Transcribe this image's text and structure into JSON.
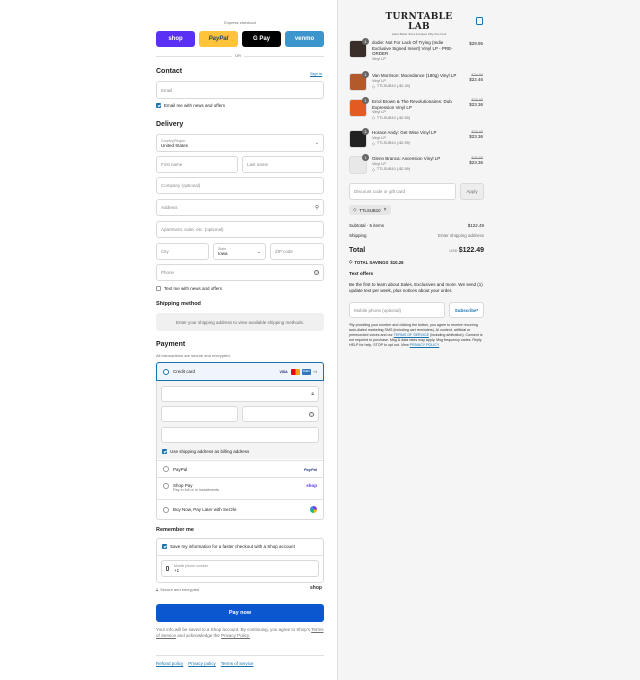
{
  "express": {
    "label": "Express checkout",
    "or": "OR",
    "buttons": [
      {
        "label": "shop",
        "bg": "#5a31f4",
        "fg": "#ffffff"
      },
      {
        "label": "PayPal",
        "bg": "#ffc439",
        "fg": "#253b80"
      },
      {
        "label": "G Pay",
        "bg": "#000000",
        "fg": "#ffffff"
      },
      {
        "label": "venmo",
        "bg": "#3d95ce",
        "fg": "#ffffff"
      }
    ]
  },
  "contact": {
    "title": "Contact",
    "sign_in": "Sign in",
    "email_placeholder": "Email",
    "news_label": "Email me with news and offers"
  },
  "delivery": {
    "title": "Delivery",
    "country_label": "Country/Region",
    "country_value": "United States",
    "first_name": "First name",
    "last_name": "Last name",
    "company": "Company (optional)",
    "address": "Address",
    "apartment": "Apartment, suite, etc. (optional)",
    "city": "City",
    "state_label": "State",
    "state_value": "Iowa",
    "zip": "ZIP code",
    "phone": "Phone",
    "text_label": "Text me with news and offers"
  },
  "shipping": {
    "title": "Shipping method",
    "note": "Enter your shipping address to view available shipping methods."
  },
  "payment": {
    "title": "Payment",
    "subtitle": "All transactions are secure and encrypted.",
    "credit_card": "Credit card",
    "card_brands": [
      "VISA",
      "MC",
      "AMEX",
      "+4"
    ],
    "billing_label": "Use shipping address as billing address",
    "paypal": "PayPal",
    "paypal_logo": "PayPal",
    "shop_pay": "Shop Pay",
    "shop_pay_sub": "Pay in full or in installments",
    "shop_logo": "shop",
    "sezzle": "Buy Now, Pay Later with Sezzle"
  },
  "remember": {
    "title": "Remember me",
    "save_label": "Save my information for a faster checkout with a Shop account",
    "mobile_label": "Mobile phone number",
    "mobile_value": "+1",
    "secure": "Secure and encrypted",
    "shop_logo": "shop"
  },
  "pay_now": "Pay now",
  "legal": {
    "text": "Your info will be saved to a Shop account. By continuing, you agree to Shop's",
    "terms": "Terms of Service",
    "and": "and acknowledge the",
    "privacy": "Privacy Policy."
  },
  "footer": [
    "Refund policy",
    "Privacy policy",
    "Terms of service"
  ],
  "brand": {
    "logo": "TURNTABLE LAB",
    "tagline": "Listen Better Since Fourteen Fifty-One Cent"
  },
  "items": [
    {
      "qty": "1",
      "name": "dodie: Not For Lack Of Trying (Indie Exclusive Signed Insert) Vinyl LP - PRE-ORDER",
      "sub": "Vinyl LP",
      "discount": "",
      "price": "$29.95",
      "orig": ""
    },
    {
      "qty": "1",
      "name": "Van Morrison: Moondance (180g) Vinyl LP",
      "sub": "Vinyl LP",
      "discount": "TTLSUB10 (-$2.49)",
      "price": "$22.46",
      "orig": "$24.95"
    },
    {
      "qty": "1",
      "name": "Errol Brown & The Revolutionaires: Dub Expression Vinyl LP",
      "sub": "Vinyl LP",
      "discount": "TTLSUB10 (-$2.59)",
      "price": "$23.36",
      "orig": "$25.95"
    },
    {
      "qty": "1",
      "name": "Horace Andy: Get Wise Vinyl LP",
      "sub": "Vinyl LP",
      "discount": "TTLSUB10 (-$2.59)",
      "price": "$23.36",
      "orig": "$25.95"
    },
    {
      "qty": "1",
      "name": "Glenn Branca: Ascension Vinyl LP",
      "sub": "Vinyl LP",
      "discount": "TTLSUB10 (-$2.59)",
      "price": "$23.36",
      "orig": "$25.95"
    }
  ],
  "discount_code": {
    "placeholder": "Discount code or gift card",
    "apply": "Apply",
    "applied": "TTLSUB10"
  },
  "summary": {
    "subtotal_label": "Subtotal · 5 items",
    "subtotal": "$122.49",
    "shipping_label": "Shipping",
    "shipping": "Enter shipping address",
    "total_label": "Total",
    "currency": "USD",
    "total": "$122.49",
    "savings_label": "TOTAL SAVINGS",
    "savings": "$10.26"
  },
  "text_offers": {
    "title": "Text offers",
    "body": "Be the first to learn about Sales, Exclusives and more. We send (1) update text per week, plus notices about your order.",
    "mobile_placeholder": "Mobile phone (optional)",
    "subscribe": "Subscribe*",
    "fine": "*By providing your number and clicking the button, you agree to receive recurring auto-dialed marketing SMS (including cart reminders). AI content, artificial or prerecorded voices and our",
    "fine_link": "TERMS OF SERVICE",
    "fine2": "(including arbitration). Consent is not required to purchase. Msg & data rates may apply. Msg frequency varies. Reply HELP for help, STOP to opt out. View",
    "fine_link2": "PRIVACY POLICY"
  },
  "colors": {
    "accent": "#1773b0",
    "pay_button": "#0b57d0"
  }
}
